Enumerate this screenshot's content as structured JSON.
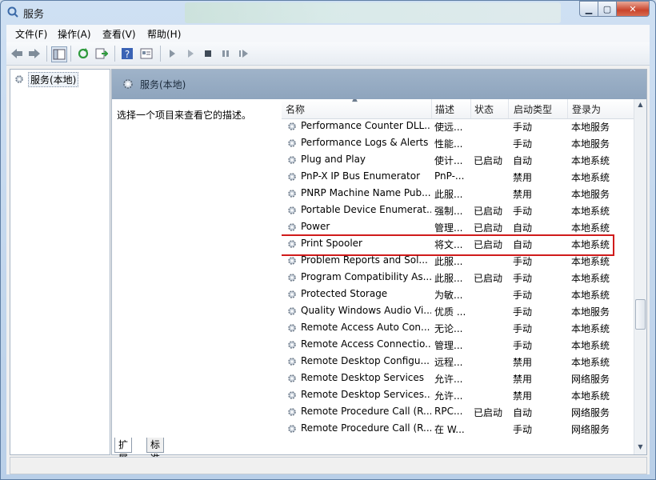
{
  "window": {
    "title": "服务"
  },
  "menus": [
    "文件(F)",
    "操作(A)",
    "查看(V)",
    "帮助(H)"
  ],
  "tree": {
    "root": "服务(本地)"
  },
  "panel": {
    "title": "服务(本地)",
    "description_hint": "选择一个项目来查看它的描述。"
  },
  "columns": {
    "name": "名称",
    "desc": "描述",
    "status": "状态",
    "startup": "启动类型",
    "logon": "登录为"
  },
  "services": [
    {
      "name": "Performance Counter DLL...",
      "desc": "使远...",
      "status": "",
      "startup": "手动",
      "logon": "本地服务"
    },
    {
      "name": "Performance Logs & Alerts",
      "desc": "性能...",
      "status": "",
      "startup": "手动",
      "logon": "本地服务"
    },
    {
      "name": "Plug and Play",
      "desc": "使计...",
      "status": "已启动",
      "startup": "自动",
      "logon": "本地系统"
    },
    {
      "name": "PnP-X IP Bus Enumerator",
      "desc": "PnP-...",
      "status": "",
      "startup": "禁用",
      "logon": "本地系统"
    },
    {
      "name": "PNRP Machine Name Pub...",
      "desc": "此服...",
      "status": "",
      "startup": "禁用",
      "logon": "本地服务"
    },
    {
      "name": "Portable Device Enumerat...",
      "desc": "强制...",
      "status": "已启动",
      "startup": "手动",
      "logon": "本地系统"
    },
    {
      "name": "Power",
      "desc": "管理...",
      "status": "已启动",
      "startup": "自动",
      "logon": "本地系统"
    },
    {
      "name": "Print Spooler",
      "desc": "将文...",
      "status": "已启动",
      "startup": "自动",
      "logon": "本地系统",
      "highlighted": true
    },
    {
      "name": "Problem Reports and Sol...",
      "desc": "此服...",
      "status": "",
      "startup": "手动",
      "logon": "本地系统"
    },
    {
      "name": "Program Compatibility As...",
      "desc": "此服...",
      "status": "已启动",
      "startup": "手动",
      "logon": "本地系统"
    },
    {
      "name": "Protected Storage",
      "desc": "为敏...",
      "status": "",
      "startup": "手动",
      "logon": "本地系统"
    },
    {
      "name": "Quality Windows Audio Vi...",
      "desc": "优质 ...",
      "status": "",
      "startup": "手动",
      "logon": "本地服务"
    },
    {
      "name": "Remote Access Auto Con...",
      "desc": "无论...",
      "status": "",
      "startup": "手动",
      "logon": "本地系统"
    },
    {
      "name": "Remote Access Connectio...",
      "desc": "管理...",
      "status": "",
      "startup": "手动",
      "logon": "本地系统"
    },
    {
      "name": "Remote Desktop Configu...",
      "desc": "远程...",
      "status": "",
      "startup": "禁用",
      "logon": "本地系统"
    },
    {
      "name": "Remote Desktop Services",
      "desc": "允许...",
      "status": "",
      "startup": "禁用",
      "logon": "网络服务"
    },
    {
      "name": "Remote Desktop Services...",
      "desc": "允许...",
      "status": "",
      "startup": "禁用",
      "logon": "本地系统"
    },
    {
      "name": "Remote Procedure Call (R...",
      "desc": "RPC...",
      "status": "已启动",
      "startup": "自动",
      "logon": "网络服务"
    },
    {
      "name": "Remote Procedure Call (R...",
      "desc": "在 W...",
      "status": "",
      "startup": "手动",
      "logon": "网络服务"
    }
  ],
  "tabs": [
    "扩展",
    "标准"
  ],
  "colors": {
    "highlight_border": "#d01b1b",
    "panel_header": "#96abc3"
  }
}
